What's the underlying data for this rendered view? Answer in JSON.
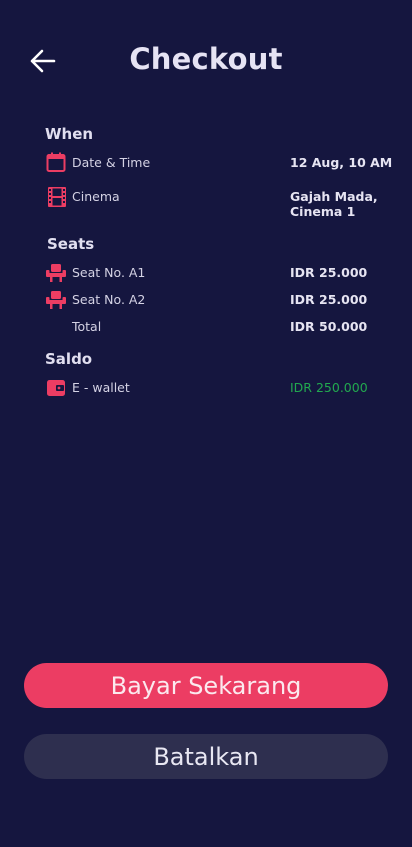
{
  "header": {
    "title": "Checkout",
    "back_icon": "arrow-left-icon"
  },
  "when": {
    "label": "When",
    "date_time": {
      "icon": "calendar-icon",
      "label": "Date & Time",
      "value": "12 Aug, 10 AM"
    },
    "cinema": {
      "icon": "film-icon",
      "label": "Cinema",
      "value_line1": "Gajah Mada,",
      "value_line2": "Cinema 1"
    }
  },
  "seats": {
    "label": "Seats",
    "items": [
      {
        "icon": "seat-icon",
        "label": "Seat No. A1",
        "value": "IDR 25.000"
      },
      {
        "icon": "seat-icon",
        "label": "Seat No. A2",
        "value": "IDR 25.000"
      }
    ],
    "total_label": "Total",
    "total_value": "IDR 50.000"
  },
  "saldo": {
    "label": "Saldo",
    "wallet": {
      "icon": "wallet-icon",
      "label": "E - wallet",
      "value": "IDR 250.000"
    }
  },
  "actions": {
    "pay_label": "Bayar Sekarang",
    "cancel_label": "Batalkan"
  },
  "colors": {
    "background": "#15163f",
    "accent": "#ec3d63",
    "balance_green": "#22a84f",
    "secondary_button": "#2e2f4f"
  }
}
